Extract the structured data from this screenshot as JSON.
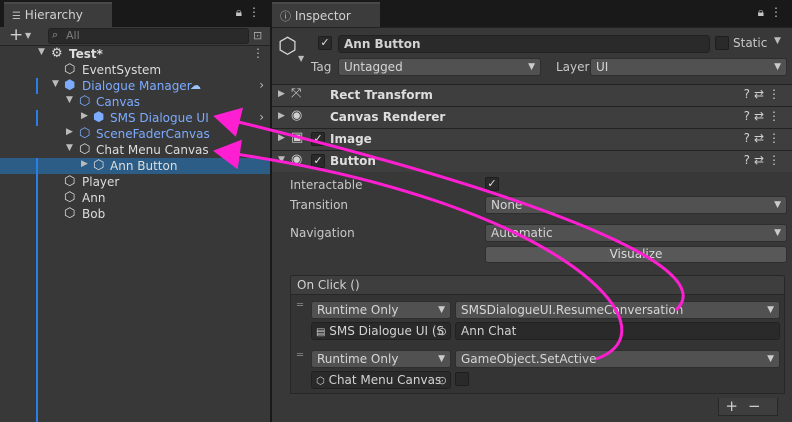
{
  "hierarchy": {
    "tab_title": "Hierarchy",
    "search_placeholder": "All",
    "items": [
      {
        "label": "Test*",
        "icon": "unity-scene-icon"
      },
      {
        "label": "EventSystem",
        "icon": "gameobject-cube-icon"
      },
      {
        "label": "Dialogue Manager",
        "icon": "prefab-cube-icon"
      },
      {
        "label": "Canvas",
        "icon": "prefab-cube-icon"
      },
      {
        "label": "SMS Dialogue UI",
        "icon": "prefab-added-icon"
      },
      {
        "label": "SceneFaderCanvas",
        "icon": "prefab-cube-icon"
      },
      {
        "label": "Chat Menu Canvas",
        "icon": "gameobject-added-icon"
      },
      {
        "label": "Ann Button",
        "icon": "gameobject-cube-icon"
      },
      {
        "label": "Player",
        "icon": "gameobject-cube-icon"
      },
      {
        "label": "Ann",
        "icon": "gameobject-cube-icon"
      },
      {
        "label": "Bob",
        "icon": "gameobject-cube-icon"
      }
    ]
  },
  "inspector": {
    "tab_title": "Inspector",
    "object_name": "Ann Button",
    "static_label": "Static",
    "tag_label": "Tag",
    "tag_value": "Untagged",
    "layer_label": "Layer",
    "layer_value": "UI",
    "components": [
      {
        "name": "Rect Transform",
        "icon": "rect-transform-icon"
      },
      {
        "name": "Canvas Renderer",
        "icon": "eye-icon"
      },
      {
        "name": "Image",
        "icon": "image-icon"
      },
      {
        "name": "Button",
        "icon": "button-icon"
      }
    ],
    "button": {
      "interactable_label": "Interactable",
      "transition_label": "Transition",
      "transition_value": "None",
      "navigation_label": "Navigation",
      "navigation_value": "Automatic",
      "visualize_label": "Visualize"
    },
    "onclick": {
      "title": "On Click ()",
      "events": [
        {
          "mode": "Runtime Only",
          "function": "SMSDialogueUI.ResumeConversation",
          "object": "SMS Dialogue UI (S",
          "argument": "Ann Chat"
        },
        {
          "mode": "Runtime Only",
          "function": "GameObject.SetActive",
          "object": "Chat Menu Canvas",
          "argument": ""
        }
      ],
      "add_remove": "+ −"
    }
  },
  "colors": {
    "selection": "#2c5d87",
    "prefab_text": "#7cabff",
    "annotation_arrow": "#ff1fd2"
  }
}
